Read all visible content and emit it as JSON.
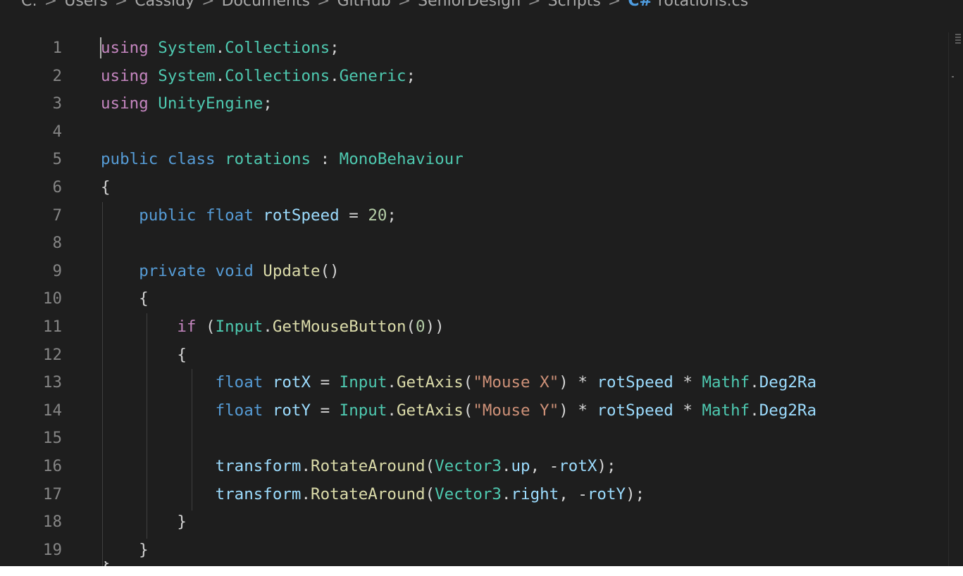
{
  "breadcrumb": {
    "items": [
      "C:",
      "Users",
      "Cassidy",
      "Documents",
      "GitHub",
      "SeniorDesign",
      "Scripts"
    ],
    "separator": ">",
    "file_icon": "C#",
    "file_name": "rotations.cs"
  },
  "editor": {
    "line_numbers": [
      "1",
      "2",
      "3",
      "4",
      "5",
      "6",
      "7",
      "8",
      "9",
      "10",
      "11",
      "12",
      "13",
      "14",
      "15",
      "16",
      "17",
      "18",
      "19"
    ],
    "lines": [
      [
        {
          "t": "using",
          "c": "ctl"
        },
        {
          "t": " "
        },
        {
          "t": "System",
          "c": "typ"
        },
        {
          "t": "."
        },
        {
          "t": "Collections",
          "c": "typ"
        },
        {
          "t": ";"
        }
      ],
      [
        {
          "t": "using",
          "c": "ctl"
        },
        {
          "t": " "
        },
        {
          "t": "System",
          "c": "typ"
        },
        {
          "t": "."
        },
        {
          "t": "Collections",
          "c": "typ"
        },
        {
          "t": "."
        },
        {
          "t": "Generic",
          "c": "typ"
        },
        {
          "t": ";"
        }
      ],
      [
        {
          "t": "using",
          "c": "ctl"
        },
        {
          "t": " "
        },
        {
          "t": "UnityEngine",
          "c": "typ"
        },
        {
          "t": ";"
        }
      ],
      [],
      [
        {
          "t": "public",
          "c": "kw"
        },
        {
          "t": " "
        },
        {
          "t": "class",
          "c": "kw"
        },
        {
          "t": " "
        },
        {
          "t": "rotations",
          "c": "typ"
        },
        {
          "t": " : "
        },
        {
          "t": "MonoBehaviour",
          "c": "typ"
        }
      ],
      [
        {
          "t": "{"
        }
      ],
      [
        {
          "t": "    "
        },
        {
          "t": "public",
          "c": "kw"
        },
        {
          "t": " "
        },
        {
          "t": "float",
          "c": "kw"
        },
        {
          "t": " "
        },
        {
          "t": "rotSpeed",
          "c": "var"
        },
        {
          "t": " = "
        },
        {
          "t": "20",
          "c": "num"
        },
        {
          "t": ";"
        }
      ],
      [],
      [
        {
          "t": "    "
        },
        {
          "t": "private",
          "c": "kw"
        },
        {
          "t": " "
        },
        {
          "t": "void",
          "c": "kw"
        },
        {
          "t": " "
        },
        {
          "t": "Update",
          "c": "fn"
        },
        {
          "t": "()"
        }
      ],
      [
        {
          "t": "    {"
        }
      ],
      [
        {
          "t": "        "
        },
        {
          "t": "if",
          "c": "ctl"
        },
        {
          "t": " ("
        },
        {
          "t": "Input",
          "c": "typ"
        },
        {
          "t": "."
        },
        {
          "t": "GetMouseButton",
          "c": "fn"
        },
        {
          "t": "("
        },
        {
          "t": "0",
          "c": "num"
        },
        {
          "t": "))"
        }
      ],
      [
        {
          "t": "        {"
        }
      ],
      [
        {
          "t": "            "
        },
        {
          "t": "float",
          "c": "kw"
        },
        {
          "t": " "
        },
        {
          "t": "rotX",
          "c": "var"
        },
        {
          "t": " = "
        },
        {
          "t": "Input",
          "c": "typ"
        },
        {
          "t": "."
        },
        {
          "t": "GetAxis",
          "c": "fn"
        },
        {
          "t": "("
        },
        {
          "t": "\"Mouse X\"",
          "c": "str"
        },
        {
          "t": ") * "
        },
        {
          "t": "rotSpeed",
          "c": "var"
        },
        {
          "t": " * "
        },
        {
          "t": "Mathf",
          "c": "typ"
        },
        {
          "t": "."
        },
        {
          "t": "Deg2Ra",
          "c": "var"
        }
      ],
      [
        {
          "t": "            "
        },
        {
          "t": "float",
          "c": "kw"
        },
        {
          "t": " "
        },
        {
          "t": "rotY",
          "c": "var"
        },
        {
          "t": " = "
        },
        {
          "t": "Input",
          "c": "typ"
        },
        {
          "t": "."
        },
        {
          "t": "GetAxis",
          "c": "fn"
        },
        {
          "t": "("
        },
        {
          "t": "\"Mouse Y\"",
          "c": "str"
        },
        {
          "t": ") * "
        },
        {
          "t": "rotSpeed",
          "c": "var"
        },
        {
          "t": " * "
        },
        {
          "t": "Mathf",
          "c": "typ"
        },
        {
          "t": "."
        },
        {
          "t": "Deg2Ra",
          "c": "var"
        }
      ],
      [],
      [
        {
          "t": "            "
        },
        {
          "t": "transform",
          "c": "var"
        },
        {
          "t": "."
        },
        {
          "t": "RotateAround",
          "c": "fn"
        },
        {
          "t": "("
        },
        {
          "t": "Vector3",
          "c": "typ"
        },
        {
          "t": "."
        },
        {
          "t": "up",
          "c": "var"
        },
        {
          "t": ", -"
        },
        {
          "t": "rotX",
          "c": "var"
        },
        {
          "t": ");"
        }
      ],
      [
        {
          "t": "            "
        },
        {
          "t": "transform",
          "c": "var"
        },
        {
          "t": "."
        },
        {
          "t": "RotateAround",
          "c": "fn"
        },
        {
          "t": "("
        },
        {
          "t": "Vector3",
          "c": "typ"
        },
        {
          "t": "."
        },
        {
          "t": "right",
          "c": "var"
        },
        {
          "t": ", -"
        },
        {
          "t": "rotY",
          "c": "var"
        },
        {
          "t": ");"
        }
      ],
      [
        {
          "t": "        }"
        }
      ],
      [
        {
          "t": "    }"
        }
      ]
    ]
  },
  "colors": {
    "background": "#1e1e1e",
    "keyword": "#569cd6",
    "control": "#c586c0",
    "type": "#4ec9b0",
    "function": "#dcdcaa",
    "variable": "#9cdcfe",
    "number": "#b5cea8",
    "string": "#ce9178"
  }
}
